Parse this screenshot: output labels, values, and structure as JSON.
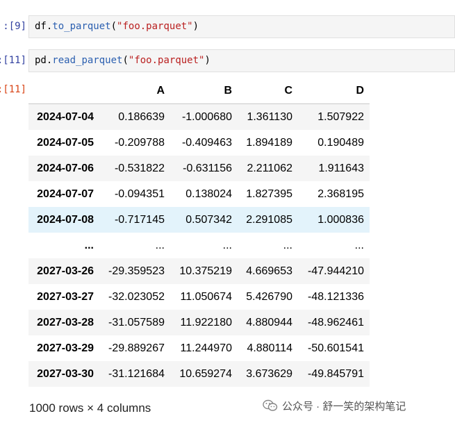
{
  "cells": [
    {
      "prompt": "[9]:",
      "code": {
        "var": "df",
        "dot": ".",
        "fn": "to_parquet",
        "open": "(",
        "str": "\"foo.parquet\"",
        "close": ")"
      }
    },
    {
      "prompt": "[11]:",
      "code": {
        "var": "pd",
        "dot": ".",
        "fn": "read_parquet",
        "open": "(",
        "str": "\"foo.parquet\"",
        "close": ")"
      }
    }
  ],
  "output_prompt": "[11]:",
  "table": {
    "columns": [
      "A",
      "B",
      "C",
      "D"
    ],
    "rows": [
      {
        "index": "2024-07-04",
        "values": [
          "0.186639",
          "-1.000680",
          "1.361130",
          "1.507922"
        ]
      },
      {
        "index": "2024-07-05",
        "values": [
          "-0.209788",
          "-0.409463",
          "1.894189",
          "0.190489"
        ]
      },
      {
        "index": "2024-07-06",
        "values": [
          "-0.531822",
          "-0.631156",
          "2.211062",
          "1.911643"
        ]
      },
      {
        "index": "2024-07-07",
        "values": [
          "-0.094351",
          "0.138024",
          "1.827395",
          "2.368195"
        ]
      },
      {
        "index": "2024-07-08",
        "values": [
          "-0.717145",
          "0.507342",
          "2.291085",
          "1.000836"
        ],
        "hover": true
      },
      {
        "index": "...",
        "values": [
          "...",
          "...",
          "...",
          "..."
        ]
      },
      {
        "index": "2027-03-26",
        "values": [
          "-29.359523",
          "10.375219",
          "4.669653",
          "-47.944210"
        ]
      },
      {
        "index": "2027-03-27",
        "values": [
          "-32.023052",
          "11.050674",
          "5.426790",
          "-48.121336"
        ]
      },
      {
        "index": "2027-03-28",
        "values": [
          "-31.057589",
          "11.922180",
          "4.880944",
          "-48.962461"
        ]
      },
      {
        "index": "2027-03-29",
        "values": [
          "-29.889267",
          "11.244970",
          "4.880114",
          "-50.601541"
        ]
      },
      {
        "index": "2027-03-30",
        "values": [
          "-31.121684",
          "10.659274",
          "3.673629",
          "-49.845791"
        ]
      }
    ]
  },
  "footer": "1000 rows × 4 columns",
  "watermark": {
    "text": "公众号 · 舒一笑的架构笔记",
    "icon": "wechat-icon"
  }
}
